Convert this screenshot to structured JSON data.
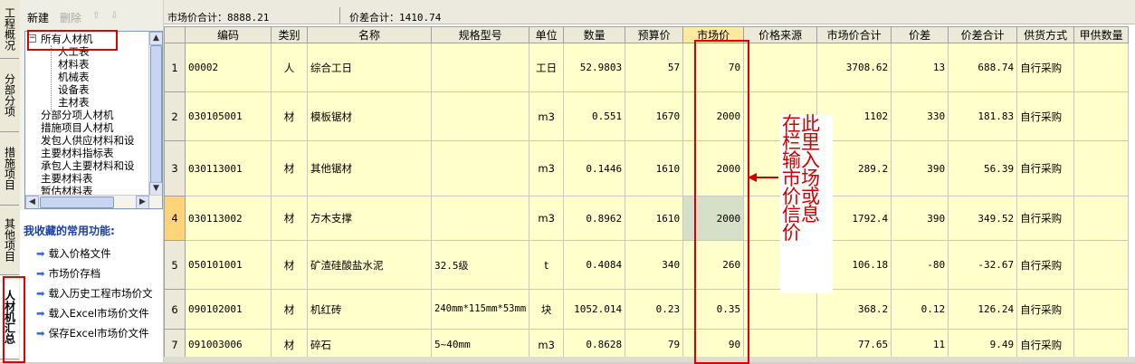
{
  "vertical_tabs": [
    "工程概况",
    "分部分项",
    "措施项目",
    "其他项目",
    "人材机汇总"
  ],
  "left_toolbar": {
    "new_label": "新建",
    "delete_label": "删除",
    "up_icon": "arrow-up-icon",
    "down_icon": "arrow-down-icon"
  },
  "tree": {
    "root": "所有人材机",
    "children": [
      "人工表",
      "材料表",
      "机械表",
      "设备表",
      "主材表"
    ],
    "siblings": [
      "分部分项人材机",
      "措施项目人材机",
      "发包人供应材料和设",
      "主要材料指标表",
      "承包人主要材料和设",
      "主要材料表",
      "暂估材料表"
    ]
  },
  "favorites": {
    "title": "我收藏的常用功能:",
    "items": [
      "载入价格文件",
      "市场价存档",
      "载入历史工程市场价文",
      "载入Excel市场价文件",
      "保存Excel市场价文件"
    ]
  },
  "summary": {
    "market_total": "市场价合计：8888.21",
    "diff_total": "价差合计：1410.74"
  },
  "table": {
    "headers": [
      "",
      "编码",
      "类别",
      "名称",
      "规格型号",
      "单位",
      "数量",
      "预算价",
      "市场价",
      "价格来源",
      "市场价合计",
      "价差",
      "价差合计",
      "供货方式",
      "甲供数量"
    ],
    "rows": [
      [
        "1",
        "00002",
        "人",
        "综合工日",
        "",
        "工日",
        "52.9803",
        "57",
        "70",
        "",
        "3708.62",
        "13",
        "688.74",
        "自行采购",
        ""
      ],
      [
        "2",
        "030105001",
        "材",
        "模板锯材",
        "",
        "m3",
        "0.551",
        "1670",
        "2000",
        "",
        "1102",
        "330",
        "181.83",
        "自行采购",
        ""
      ],
      [
        "3",
        "030113001",
        "材",
        "其他锯材",
        "",
        "m3",
        "0.1446",
        "1610",
        "2000",
        "",
        "289.2",
        "390",
        "56.39",
        "自行采购",
        ""
      ],
      [
        "4",
        "030113002",
        "材",
        "方木支撑",
        "",
        "m3",
        "0.8962",
        "1610",
        "2000",
        "",
        "1792.4",
        "390",
        "349.52",
        "自行采购",
        ""
      ],
      [
        "5",
        "050101001",
        "材",
        "矿渣硅酸盐水泥",
        "32.5级",
        "t",
        "0.4084",
        "340",
        "260",
        "",
        "106.18",
        "-80",
        "-32.67",
        "自行采购",
        ""
      ],
      [
        "6",
        "090102001",
        "材",
        "机红砖",
        "240mm*115mm*53mm",
        "块",
        "1052.014",
        "0.23",
        "0.35",
        "",
        "368.2",
        "0.12",
        "126.24",
        "自行采购",
        ""
      ],
      [
        "7",
        "091003006",
        "材",
        "碎石",
        "5~40mm",
        "m3",
        "0.8628",
        "79",
        "90",
        "",
        "77.65",
        "11",
        "9.49",
        "自行采购",
        ""
      ]
    ]
  },
  "annotation": {
    "text": "在此栏里输入市场价或信息价",
    "color": "#d00000"
  }
}
